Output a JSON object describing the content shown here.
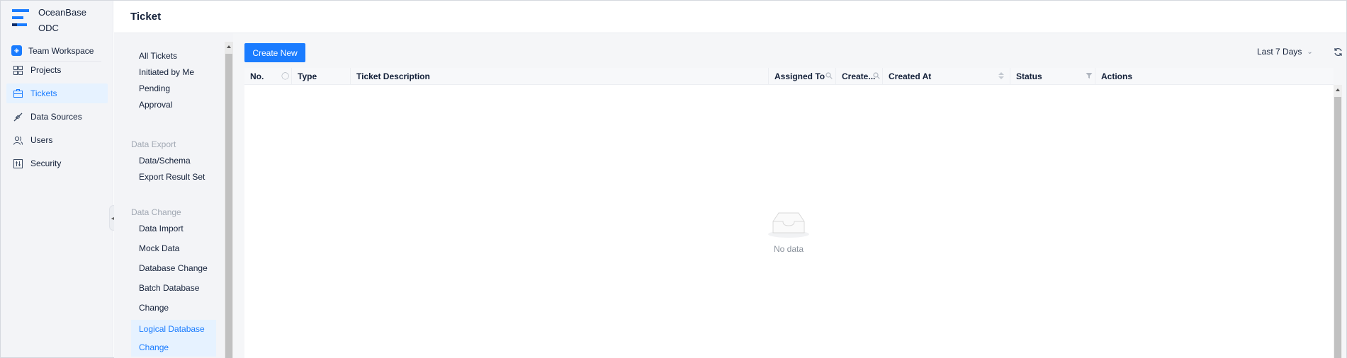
{
  "brand": {
    "line1": "OceanBase",
    "line2": "ODC"
  },
  "workspace": {
    "label": "Team Workspace"
  },
  "nav": {
    "items": [
      {
        "label": "Projects",
        "icon": "projects-icon"
      },
      {
        "label": "Tickets",
        "icon": "tickets-icon",
        "active": true
      },
      {
        "label": "Data Sources",
        "icon": "data-sources-icon"
      },
      {
        "label": "Users",
        "icon": "users-icon"
      },
      {
        "label": "Security",
        "icon": "security-icon"
      }
    ]
  },
  "page": {
    "title": "Ticket"
  },
  "ticket_types": {
    "top": [
      "All Tickets",
      "Initiated by Me",
      "Pending",
      "Approval"
    ],
    "groups": [
      {
        "title": "Data Export",
        "items": [
          "Data/Schema",
          "Export Result Set"
        ]
      },
      {
        "title": "Data Change",
        "items": [
          "Data Import",
          "Mock Data",
          "Database Change",
          "Batch Database",
          "Change",
          "Logical Database",
          "Change"
        ]
      }
    ],
    "active": "Logical Database Change"
  },
  "toolbar": {
    "create_label": "Create New",
    "time_range": "Last 7 Days"
  },
  "table": {
    "columns": [
      "No.",
      "Type",
      "Ticket Description",
      "Assigned To",
      "Create...",
      "Created At",
      "Status",
      "Actions"
    ],
    "rows": [],
    "empty_text": "No data"
  },
  "colors": {
    "accent": "#1a7cff",
    "sidebar_bg": "#f3f4f7",
    "active_bg": "#e6f2ff",
    "text": "#132039",
    "muted": "#a1a8b3"
  }
}
